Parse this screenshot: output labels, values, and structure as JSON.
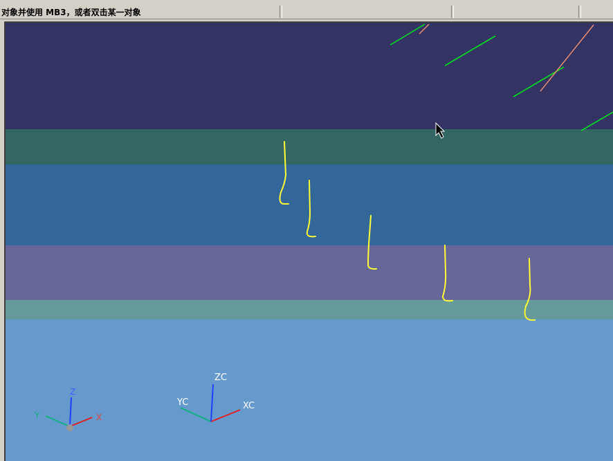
{
  "status_bar": {
    "prompt": "对象并使用 MB3，或者双击某一对象"
  },
  "viewport": {
    "bands": [
      {
        "name": "band-dark-navy",
        "color": "#343464"
      },
      {
        "name": "band-teal",
        "color": "#346664"
      },
      {
        "name": "band-blue",
        "color": "#336699"
      },
      {
        "name": "band-purple",
        "color": "#666699"
      },
      {
        "name": "band-sage",
        "color": "#669999"
      },
      {
        "name": "band-light-blue",
        "color": "#6699cc"
      }
    ],
    "work_triad": {
      "x_label": "XC",
      "y_label": "YC",
      "z_label": "ZC"
    },
    "absolute_triad": {
      "x_label": "X",
      "y_label": "Y",
      "z_label": "Z"
    },
    "colors": {
      "curve_yellow": "#ffff33",
      "curve_green": "#00e020",
      "curve_salmon": "#f09070",
      "axis_x": "#e02020",
      "axis_y": "#10b080",
      "axis_z": "#2040ff"
    }
  }
}
